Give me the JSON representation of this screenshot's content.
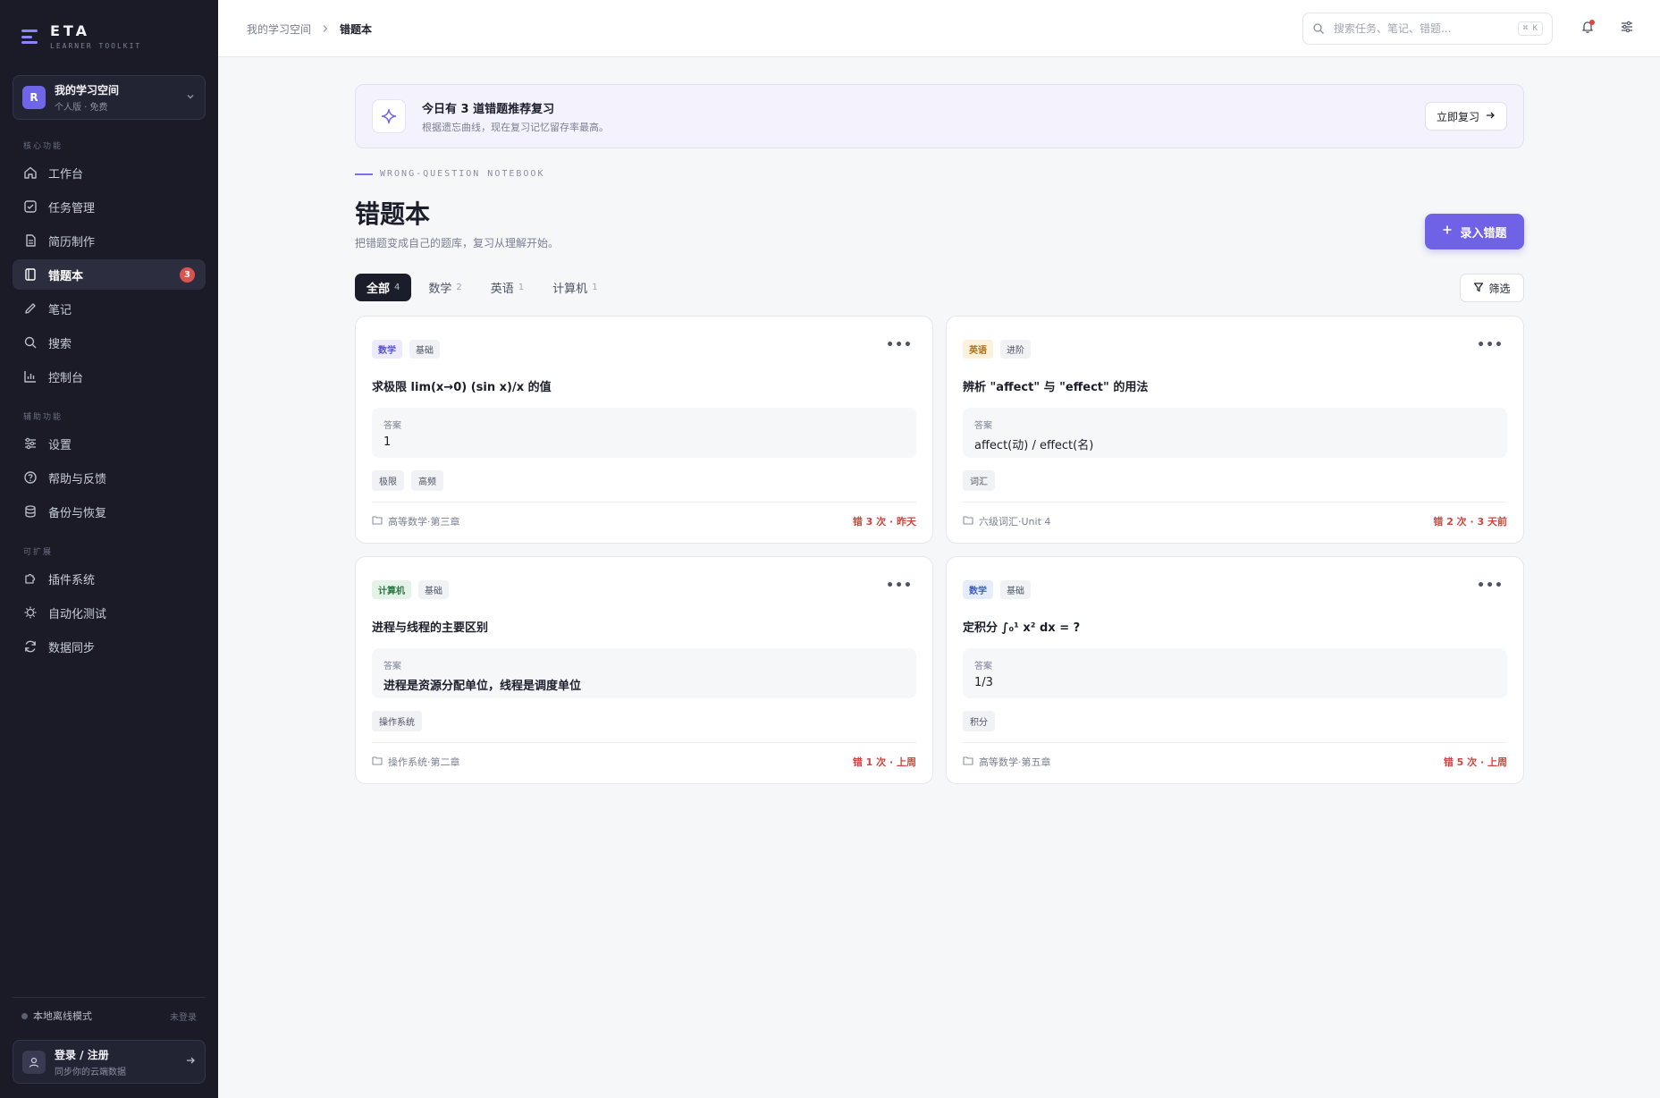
{
  "brand": {
    "name": "ETA",
    "subtitle": "LEARNER TOOLKIT"
  },
  "workspace": {
    "avatar": "R",
    "name": "我的学习空间",
    "plan": "个人版 · 免费"
  },
  "sidebar": {
    "section_core": "核心功能",
    "section_aux": "辅助功能",
    "section_ext": "可扩展",
    "core": [
      {
        "label": "工作台",
        "icon": "home-icon"
      },
      {
        "label": "任务管理",
        "icon": "check-square-icon"
      },
      {
        "label": "简历制作",
        "icon": "file-icon"
      },
      {
        "label": "错题本",
        "icon": "notebook-icon",
        "active": true,
        "badge": "3"
      },
      {
        "label": "笔记",
        "icon": "pen-icon"
      },
      {
        "label": "搜索",
        "icon": "search-icon"
      },
      {
        "label": "控制台",
        "icon": "chart-icon"
      }
    ],
    "aux": [
      {
        "label": "设置",
        "icon": "sliders-icon"
      },
      {
        "label": "帮助与反馈",
        "icon": "help-icon"
      },
      {
        "label": "备份与恢复",
        "icon": "database-icon"
      }
    ],
    "ext": [
      {
        "label": "插件系统",
        "icon": "puzzle-icon"
      },
      {
        "label": "自动化测试",
        "icon": "chip-icon"
      },
      {
        "label": "数据同步",
        "icon": "sync-icon"
      }
    ],
    "offline_label": "本地离线模式",
    "offline_status": "未登录",
    "login_title": "登录 / 注册",
    "login_sub": "同步你的云端数据"
  },
  "topbar": {
    "breadcrumb_root": "我的学习空间",
    "breadcrumb_current": "错题本",
    "search_placeholder": "搜索任务、笔记、错题...",
    "search_shortcut": "⌘ K"
  },
  "banner": {
    "title": "今日有 3 道错题推荐复习",
    "subtitle": "根据遗忘曲线，现在复习记忆留存率最高。",
    "button": "立即复习"
  },
  "page": {
    "eyebrow": "WRONG-QUESTION NOTEBOOK",
    "title": "错题本",
    "subtitle": "把错题变成自己的题库，复习从理解开始。",
    "add_button": "录入错题",
    "filter_button": "筛选"
  },
  "tabs": [
    {
      "label": "全部",
      "count": "4",
      "active": true
    },
    {
      "label": "数学",
      "count": "2"
    },
    {
      "label": "英语",
      "count": "1"
    },
    {
      "label": "计算机",
      "count": "1"
    }
  ],
  "colors": {
    "accent": "#6f62e6",
    "sidebar_bg": "#1a1b26",
    "danger": "#d0443e"
  },
  "cards": [
    {
      "subject": "数学",
      "subject_color": "#5b4fd6",
      "subject_bg": "#ecebfb",
      "level": "基础",
      "question": "求极限 lim(x→0) (sin x)/x 的值",
      "answer_label": "答案",
      "answer": "1",
      "tags": [
        "极限",
        "高频"
      ],
      "source": "高等数学·第三章",
      "stats": "错 3 次 · 昨天"
    },
    {
      "subject": "英语",
      "subject_color": "#a8741a",
      "subject_bg": "#fbf1dc",
      "level": "进阶",
      "question": "辨析 \"affect\" 与 \"effect\" 的用法",
      "answer_label": "答案",
      "answer": "affect(动) / effect(名)",
      "tags": [
        "词汇"
      ],
      "source": "六级词汇·Unit 4",
      "stats": "错 2 次 · 3 天前"
    },
    {
      "subject": "计算机",
      "subject_color": "#2f7a46",
      "subject_bg": "#e3f3e8",
      "level": "基础",
      "question": "进程与线程的主要区别",
      "answer_label": "答案",
      "answer": "进程是资源分配单位，线程是调度单位",
      "tags": [
        "操作系统"
      ],
      "source": "操作系统·第二章",
      "stats": "错 1 次 · 上周"
    },
    {
      "subject": "数学",
      "subject_color": "#3c5fb8",
      "subject_bg": "#e6ecfa",
      "level": "基础",
      "question": "定积分 ∫₀¹ x² dx = ?",
      "answer_label": "答案",
      "answer": "1/3",
      "tags": [
        "积分"
      ],
      "source": "高等数学·第五章",
      "stats": "错 5 次 · 上周"
    }
  ]
}
